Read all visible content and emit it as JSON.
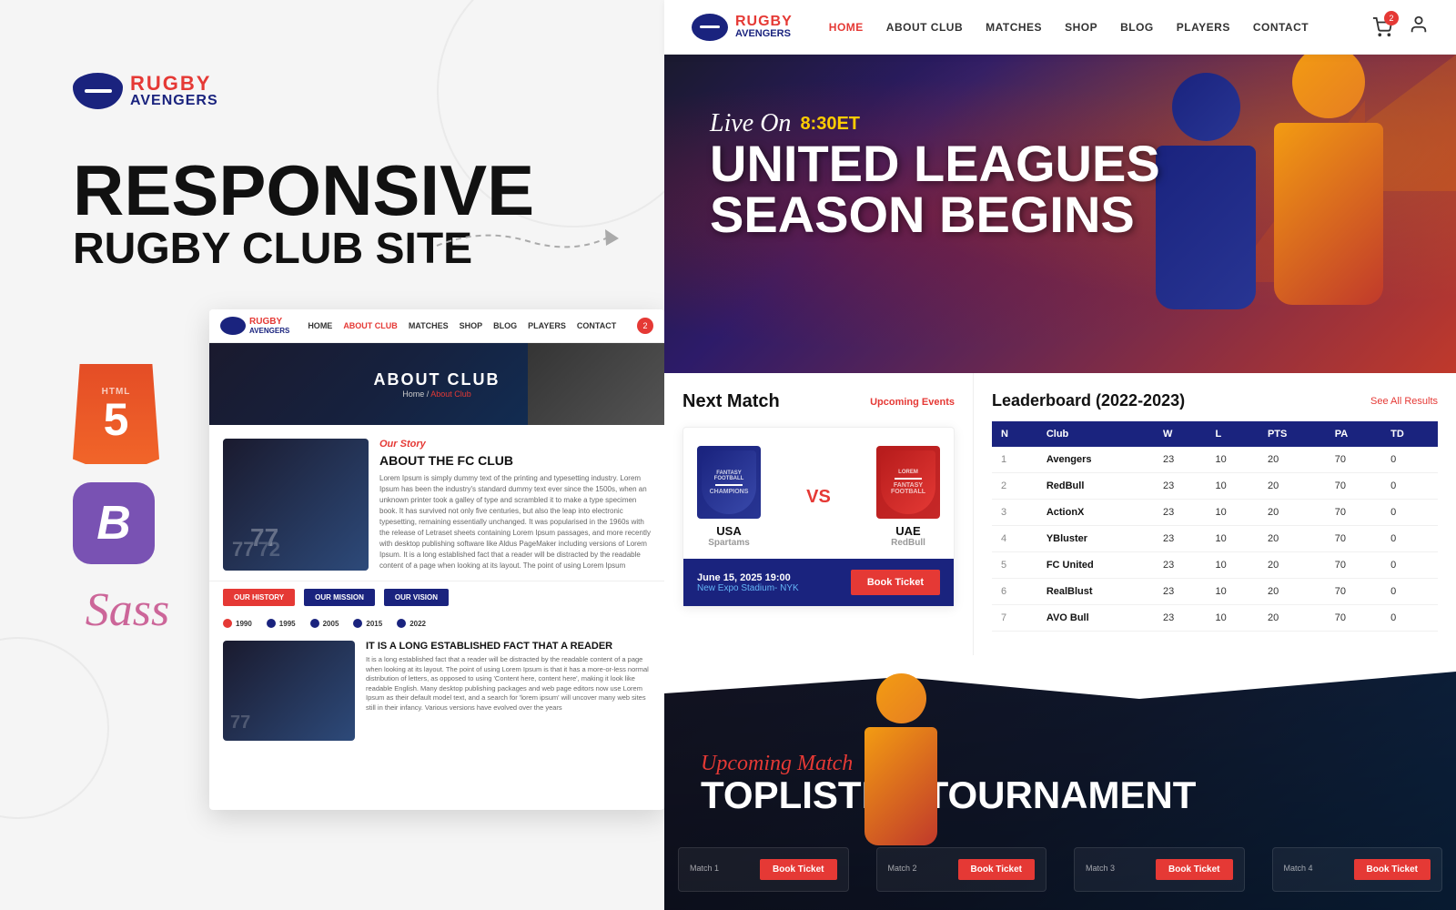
{
  "left": {
    "logo": {
      "rugby": "RUGBY",
      "avengers": "AVENGERS"
    },
    "headline1": "RESPONSIVE",
    "headline2": "RUGBY CLUB SITE",
    "tech_icons": [
      "HTML5",
      "Bootstrap",
      "Sass"
    ],
    "about_browser": {
      "nav": {
        "links": [
          "HOME",
          "ABOUT CLUB",
          "MATCHES",
          "SHOP",
          "BLOG",
          "PLAYERS",
          "CONTACT"
        ],
        "active": "ABOUT CLUB",
        "cart_count": "2"
      },
      "hero": {
        "title": "ABOUT CLUB",
        "breadcrumb": "Home / About Club"
      },
      "content": {
        "our_story": "Our Story",
        "title": "ABOUT THE FC CLUB",
        "para": "Lorem Ipsum is simply dummy text of the printing and typesetting industry. Lorem Ipsum has been the industry's standard dummy text ever since the 1500s, when an unknown printer took a galley of type and scrambled it to make a type specimen book. It has survived not only five centuries, but also the leap into electronic typesetting, remaining essentially unchanged. It was popularised in the 1960s with the release of Letraset sheets containing Lorem Ipsum passages, and more recently with desktop publishing software like Aldus PageMaker including versions of Lorem Ipsum. It is a long established fact that a reader will be distracted by the readable content of a page when looking at its layout. The point of using Lorem Ipsum"
      },
      "tabs": [
        {
          "label": "OUR HISTORY",
          "active": true
        },
        {
          "label": "OUR MISSION",
          "active": false
        },
        {
          "label": "OUR VISION",
          "active": false
        }
      ],
      "timeline": [
        "1990",
        "1995",
        "2005",
        "2015",
        "2022"
      ],
      "history": {
        "title": "IT IS A LONG ESTABLISHED FACT THAT A READER",
        "para": "It is a long established fact that a reader will be distracted by the readable content of a page when looking at its layout. The point of using Lorem Ipsum is that it has a more-or-less normal distribution of letters, as opposed to using 'Content here, content here', making it look like readable English. Many desktop publishing packages and web page editors now use Lorem Ipsum as their default model text, and a search for 'lorem ipsum' will uncover many web sites still in their infancy. Various versions have evolved over the years"
      }
    }
  },
  "right": {
    "header": {
      "logo": {
        "rugby": "RUGBY",
        "avengers": "AVENGERS"
      },
      "nav": [
        "HOME",
        "ABOUT CLUB",
        "MATCHES",
        "SHOP",
        "BLOG",
        "PLAYERS",
        "CONTACT"
      ],
      "active_nav": "HOME",
      "cart_count": "2"
    },
    "hero": {
      "live_label": "Live On",
      "time": "8:30ET",
      "title_line1": "UNITED LEAGUES",
      "title_line2": "SEASON BEGINS"
    },
    "next_match": {
      "title": "Next Match",
      "link": "Upcoming Events",
      "team1": {
        "badge_top": "FANTASY FOOTBALL",
        "badge_sub": "CHAMPIONS",
        "name": "USA",
        "sub": "Spartams"
      },
      "vs": "VS",
      "team2": {
        "badge_top": "LOREM",
        "badge_sub": "FANTASY FOOTBALL",
        "name": "UAE",
        "sub": "RedBull"
      },
      "date": "June 15, 2025 19:00",
      "venue": "New Expo Stadium- NYK",
      "book_label": "Book Ticket"
    },
    "leaderboard": {
      "title": "Leaderboard (2022-2023)",
      "link": "See All Results",
      "columns": [
        "N",
        "Club",
        "W",
        "L",
        "PTS",
        "PA",
        "TD"
      ],
      "rows": [
        {
          "n": "1",
          "club": "Avengers",
          "w": "23",
          "l": "10",
          "pts": "20",
          "pa": "70",
          "td": "0"
        },
        {
          "n": "2",
          "club": "RedBull",
          "w": "23",
          "l": "10",
          "pts": "20",
          "pa": "70",
          "td": "0"
        },
        {
          "n": "3",
          "club": "ActionX",
          "w": "23",
          "l": "10",
          "pts": "20",
          "pa": "70",
          "td": "0"
        },
        {
          "n": "4",
          "club": "YBluster",
          "w": "23",
          "l": "10",
          "pts": "20",
          "pa": "70",
          "td": "0"
        },
        {
          "n": "5",
          "club": "FC United",
          "w": "23",
          "l": "10",
          "pts": "20",
          "pa": "70",
          "td": "0"
        },
        {
          "n": "6",
          "club": "RealBlust",
          "w": "23",
          "l": "10",
          "pts": "20",
          "pa": "70",
          "td": "0"
        },
        {
          "n": "7",
          "club": "AVO Bull",
          "w": "23",
          "l": "10",
          "pts": "20",
          "pa": "70",
          "td": "0"
        }
      ]
    },
    "dark_section": {
      "upcoming_label": "Upcoming Match",
      "title": "TOPLISTED TOURNAMENT",
      "book_label": "Book Ticket"
    }
  },
  "colors": {
    "primary_red": "#e53935",
    "primary_navy": "#1a237e",
    "accent_orange": "#f39c12",
    "text_dark": "#111111",
    "text_gray": "#666666"
  }
}
